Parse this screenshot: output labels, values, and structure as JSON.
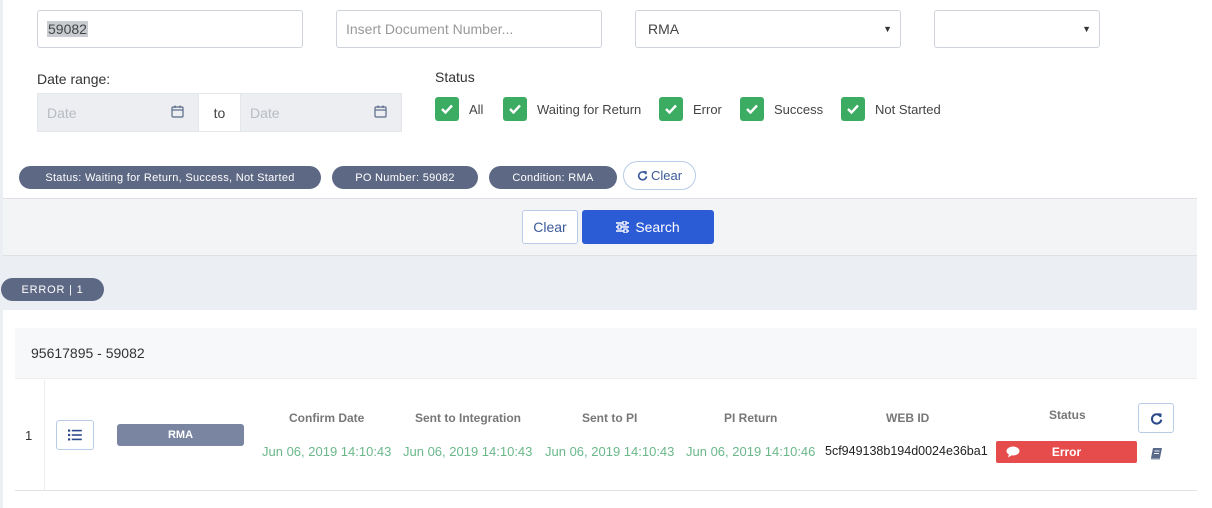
{
  "filters": {
    "po_number_value": "59082",
    "document_placeholder": "Insert Document Number...",
    "condition_value": "RMA",
    "extra_select_value": "",
    "date_range_label": "Date range:",
    "date_from_placeholder": "Date",
    "date_to_label": "to",
    "date_to_placeholder": "Date",
    "status_label": "Status",
    "status_options": [
      {
        "label": "All",
        "checked": true
      },
      {
        "label": "Waiting for Return",
        "checked": true
      },
      {
        "label": "Error",
        "checked": true
      },
      {
        "label": "Success",
        "checked": true
      },
      {
        "label": "Not Started",
        "checked": true
      }
    ]
  },
  "active_filters": {
    "status": "Status: Waiting for Return, Success, Not Started",
    "po": "PO Number: 59082",
    "condition": "Condition: RMA",
    "clear_label": "Clear"
  },
  "actions": {
    "clear_label": "Clear",
    "search_label": "Search"
  },
  "group": {
    "label": "ERROR | 1"
  },
  "result": {
    "header": "95617895 - 59082",
    "rows": [
      {
        "index": "1",
        "type": "RMA",
        "confirm_date": "Jun 06, 2019 14:10:43",
        "sent_integration": "Jun 06, 2019 14:10:43",
        "sent_pi": "Jun 06, 2019 14:10:43",
        "pi_return": "Jun 06, 2019 14:10:46",
        "web_id": "5cf949138b194d0024e36ba1",
        "status": "Error"
      }
    ],
    "columns": {
      "confirm_date": "Confirm Date",
      "sent_integration": "Sent to Integration",
      "sent_pi": "Sent to PI",
      "pi_return": "PI Return",
      "web_id": "WEB ID",
      "status": "Status"
    }
  },
  "colors": {
    "accent": "#2c5bd6",
    "check_green": "#3dac63",
    "pill": "#5d6884",
    "error": "#e74c4c",
    "date_green": "#6ab88a"
  },
  "icons": {
    "calendar": "calendar-icon",
    "check": "check-icon",
    "refresh": "refresh-icon",
    "sliders": "sliders-icon",
    "list": "list-icon",
    "comment": "comment-icon",
    "book": "book-icon"
  }
}
